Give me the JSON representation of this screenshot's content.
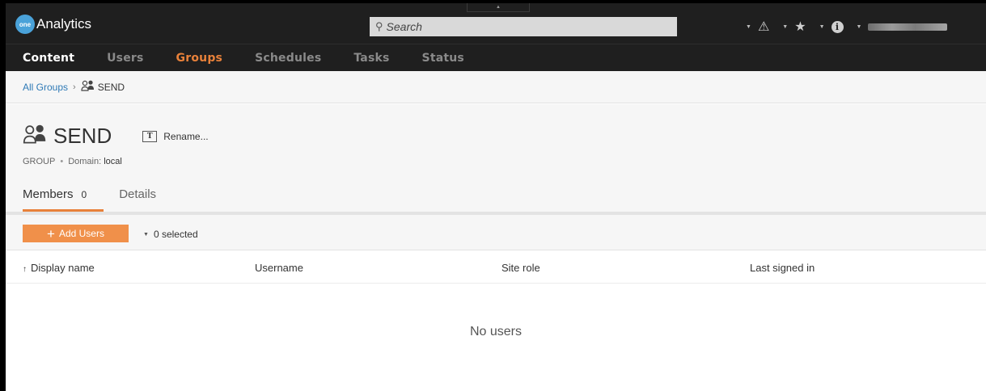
{
  "app": {
    "logo_badge": "one",
    "title": "Analytics",
    "brand_color": "#4aa2d9"
  },
  "search": {
    "placeholder": "Search",
    "icon": "search-icon"
  },
  "top_icons": [
    {
      "name": "alerts-icon",
      "glyph": "▲"
    },
    {
      "name": "favorites-icon",
      "glyph": "★"
    },
    {
      "name": "help-icon",
      "glyph": "i"
    }
  ],
  "nav": {
    "items": [
      "Content",
      "Users",
      "Groups",
      "Schedules",
      "Tasks",
      "Status"
    ],
    "accent": "#e8813a"
  },
  "breadcrumb": {
    "root": "All Groups",
    "separator": "›",
    "current": "SEND"
  },
  "header": {
    "title": "SEND",
    "rename_icon": "T",
    "rename_label": "Rename...",
    "type": "GROUP",
    "bullet": "•",
    "domain_label": "Domain:",
    "domain_value": "local"
  },
  "tabs": [
    {
      "label": "Members",
      "count": "0"
    },
    {
      "label": "Details"
    }
  ],
  "toolbar": {
    "add_icon": "+",
    "add_label": "Add Users",
    "selected_label": "0 selected"
  },
  "table": {
    "sort_indicator": "↑",
    "columns": [
      "Display name",
      "Username",
      "Site role",
      "Last signed in"
    ],
    "rows": [],
    "empty_text": "No users"
  }
}
